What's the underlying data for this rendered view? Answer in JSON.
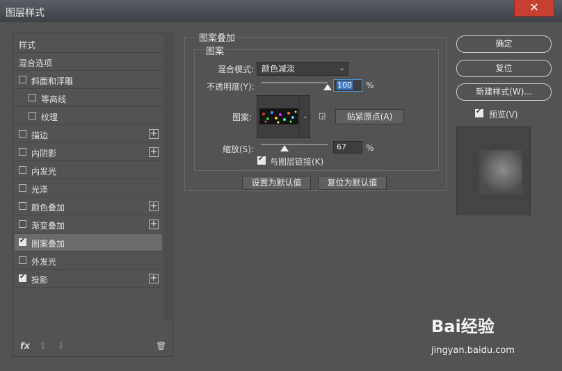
{
  "window": {
    "title": "图层样式",
    "close_label": "✕"
  },
  "left": {
    "items": [
      {
        "label": "样式",
        "checkbox": false,
        "checked": false,
        "plus": false
      },
      {
        "label": "混合选项",
        "checkbox": false,
        "checked": false,
        "plus": false
      },
      {
        "label": "斜面和浮雕",
        "checkbox": true,
        "checked": false,
        "plus": false
      },
      {
        "label": "等高线",
        "checkbox": true,
        "checked": false,
        "plus": false
      },
      {
        "label": "纹理",
        "checkbox": true,
        "checked": false,
        "plus": false
      },
      {
        "label": "描边",
        "checkbox": true,
        "checked": false,
        "plus": true
      },
      {
        "label": "内阴影",
        "checkbox": true,
        "checked": false,
        "plus": true
      },
      {
        "label": "内发光",
        "checkbox": true,
        "checked": false,
        "plus": false
      },
      {
        "label": "光泽",
        "checkbox": true,
        "checked": false,
        "plus": false
      },
      {
        "label": "颜色叠加",
        "checkbox": true,
        "checked": false,
        "plus": true
      },
      {
        "label": "渐变叠加",
        "checkbox": true,
        "checked": false,
        "plus": true
      },
      {
        "label": "图案叠加",
        "checkbox": true,
        "checked": true,
        "plus": false,
        "selected": true
      },
      {
        "label": "外发光",
        "checkbox": true,
        "checked": false,
        "plus": false
      },
      {
        "label": "投影",
        "checkbox": true,
        "checked": true,
        "plus": true
      }
    ],
    "plus_symbol": "+",
    "footer": {
      "fx": "fx",
      "up": "⇧",
      "down": "⇩",
      "trash": "🗑"
    }
  },
  "main": {
    "group_title": "图案叠加",
    "subgroup_title": "图案",
    "blend_label": "混合模式:",
    "blend_value": "颜色减淡",
    "opacity_label": "不透明度(Y):",
    "opacity_value": "100",
    "percent": "%",
    "pattern_label": "图案:",
    "snap_button": "贴紧原点(A)",
    "scale_label": "缩放(S):",
    "scale_value": "67",
    "link_label": "与图层链接(K)",
    "link_checked": true,
    "opacity_level": 1.0,
    "scale_level": 0.35,
    "default_button": "设置为默认值",
    "reset_default_button": "复位为默认值"
  },
  "right": {
    "ok": "确定",
    "reset": "复位",
    "new_style": "新建样式(W)...",
    "preview_label": "预览(V)",
    "preview_checked": true
  },
  "watermark": {
    "brand": "Bai经验",
    "url": "jingyan.baidu.com"
  }
}
